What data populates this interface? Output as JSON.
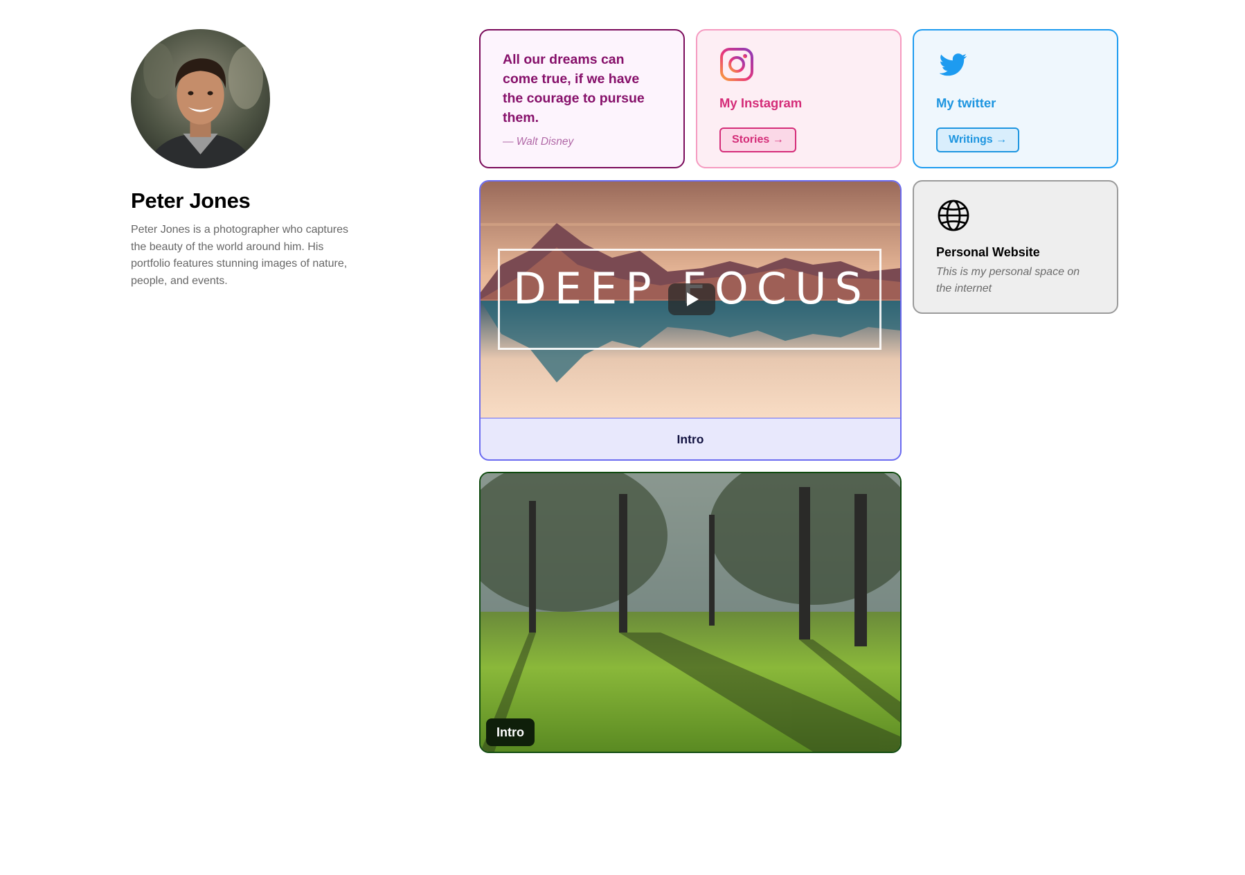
{
  "profile": {
    "name": "Peter Jones",
    "bio": "Peter Jones is a photographer who captures the beauty of the world around him. His portfolio features stunning images of nature, people, and events."
  },
  "quote_card": {
    "text": "All our dreams can come true, if we have the courage to pursue them.",
    "author": "— Walt Disney"
  },
  "instagram_card": {
    "icon": "instagram-icon",
    "title": "My Instagram",
    "button_label": "Stories →"
  },
  "twitter_card": {
    "icon": "twitter-bird-icon",
    "title": "My twitter",
    "button_label": "Writings →"
  },
  "video_card": {
    "thumbnail_text": "DEEP FOCUS",
    "caption": "Intro"
  },
  "website_card": {
    "icon": "globe-icon",
    "title": "Personal Website",
    "description": "This is my personal space on the internet"
  },
  "photo_card": {
    "badge": "Intro"
  },
  "colors": {
    "quote_accent": "#86106a",
    "instagram_accent": "#d42c78",
    "twitter_accent": "#1d95e0",
    "video_accent": "#6a6af0",
    "photo_accent": "#0f4a0f"
  }
}
